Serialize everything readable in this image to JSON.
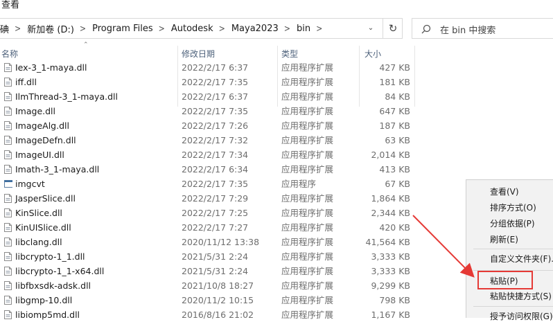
{
  "menu": {
    "view_label": "查看"
  },
  "address": {
    "crumbs": [
      "碘",
      "新加卷 (D:)",
      "Program Files",
      "Autodesk",
      "Maya2023",
      "bin"
    ],
    "separator": ">"
  },
  "search": {
    "placeholder": "在 bin 中搜索"
  },
  "columns": {
    "name": "名称",
    "date": "修改日期",
    "type": "类型",
    "size": "大小"
  },
  "files": [
    {
      "name": "Iex-3_1-maya.dll",
      "date": "2022/2/17 6:37",
      "type": "应用程序扩展",
      "size": "427 KB",
      "icon": "dll-file-icon"
    },
    {
      "name": "iff.dll",
      "date": "2022/2/17 7:35",
      "type": "应用程序扩展",
      "size": "181 KB",
      "icon": "dll-file-icon"
    },
    {
      "name": "IlmThread-3_1-maya.dll",
      "date": "2022/2/17 6:37",
      "type": "应用程序扩展",
      "size": "84 KB",
      "icon": "dll-file-icon"
    },
    {
      "name": "Image.dll",
      "date": "2022/2/17 7:35",
      "type": "应用程序扩展",
      "size": "647 KB",
      "icon": "dll-file-icon"
    },
    {
      "name": "ImageAlg.dll",
      "date": "2022/2/17 7:26",
      "type": "应用程序扩展",
      "size": "187 KB",
      "icon": "dll-file-icon"
    },
    {
      "name": "ImageDefn.dll",
      "date": "2022/2/17 7:32",
      "type": "应用程序扩展",
      "size": "63 KB",
      "icon": "dll-file-icon"
    },
    {
      "name": "ImageUI.dll",
      "date": "2022/2/17 7:34",
      "type": "应用程序扩展",
      "size": "2,014 KB",
      "icon": "dll-file-icon"
    },
    {
      "name": "Imath-3_1-maya.dll",
      "date": "2022/2/17 6:34",
      "type": "应用程序扩展",
      "size": "413 KB",
      "icon": "dll-file-icon"
    },
    {
      "name": "imgcvt",
      "date": "2022/2/17 7:35",
      "type": "应用程序",
      "size": "67 KB",
      "icon": "exe-app-icon"
    },
    {
      "name": "JasperSlice.dll",
      "date": "2022/2/17 7:29",
      "type": "应用程序扩展",
      "size": "1,864 KB",
      "icon": "dll-file-icon"
    },
    {
      "name": "KinSlice.dll",
      "date": "2022/2/17 7:25",
      "type": "应用程序扩展",
      "size": "2,344 KB",
      "icon": "dll-file-icon"
    },
    {
      "name": "KinUISlice.dll",
      "date": "2022/2/17 7:27",
      "type": "应用程序扩展",
      "size": "420 KB",
      "icon": "dll-file-icon"
    },
    {
      "name": "libclang.dll",
      "date": "2020/11/12 13:38",
      "type": "应用程序扩展",
      "size": "41,564 KB",
      "icon": "dll-file-icon"
    },
    {
      "name": "libcrypto-1_1.dll",
      "date": "2021/5/31 2:24",
      "type": "应用程序扩展",
      "size": "3,333 KB",
      "icon": "dll-file-icon"
    },
    {
      "name": "libcrypto-1_1-x64.dll",
      "date": "2021/5/31 2:24",
      "type": "应用程序扩展",
      "size": "3,333 KB",
      "icon": "dll-file-icon"
    },
    {
      "name": "libfbxsdk-adsk.dll",
      "date": "2021/10/8 18:27",
      "type": "应用程序扩展",
      "size": "9,299 KB",
      "icon": "dll-file-icon"
    },
    {
      "name": "libgmp-10.dll",
      "date": "2020/11/2 10:15",
      "type": "应用程序扩展",
      "size": "798 KB",
      "icon": "dll-file-icon"
    },
    {
      "name": "libiomp5md.dll",
      "date": "2016/8/16 21:02",
      "type": "应用程序扩展",
      "size": "1,167 KB",
      "icon": "dll-file-icon"
    }
  ],
  "context_menu": {
    "items": [
      "查看(V)",
      "排序方式(O)",
      "分组依据(P)",
      "刷新(E)",
      "自定义文件夹(F)...",
      "粘贴(P)",
      "粘贴快捷方式(S)",
      "授予访问权限(G)"
    ],
    "highlighted": "粘贴(P)"
  },
  "annotation": {
    "color": "#e53935"
  }
}
